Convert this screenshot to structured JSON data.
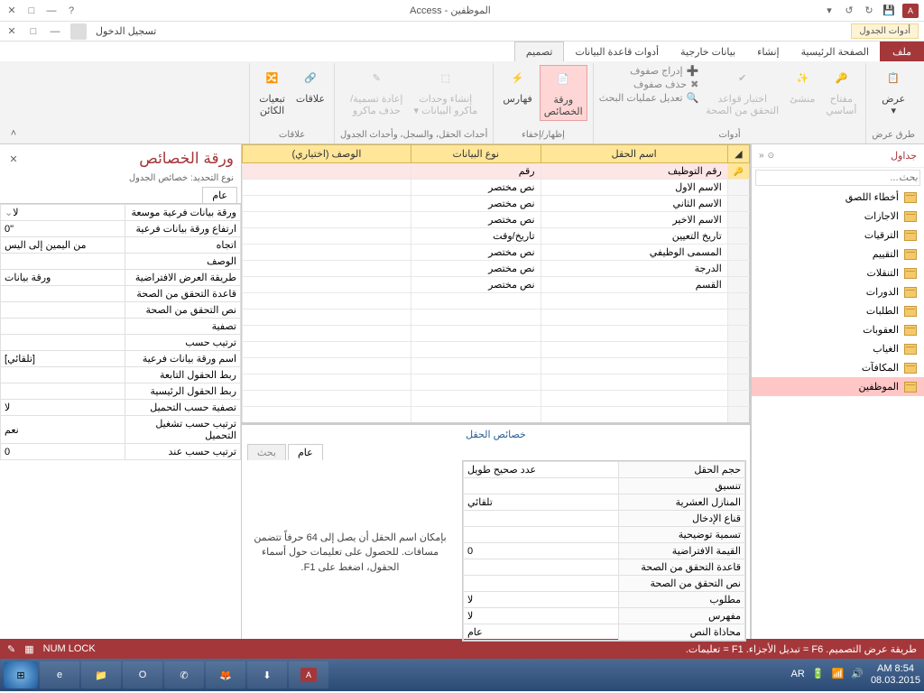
{
  "title": "الموظفين - Access",
  "signin": "تسجيل الدخول",
  "toolContext": "أدوات الجدول",
  "tabs": {
    "file": "ملف",
    "home": "الصفحة الرئيسية",
    "create": "إنشاء",
    "external": "بيانات خارجية",
    "dbtools": "أدوات قاعدة البيانات",
    "design": "تصميم"
  },
  "ribbon": {
    "view": "عرض",
    "viewGroup": "طرق عرض",
    "pk": "مفتاح\nأساسي",
    "builder": "منشئ",
    "testRules": "اختبار قواعد\nالتحقق من الصحة",
    "insertRows": "إدراج صفوف",
    "deleteRows": "حذف صفوف",
    "modifyLookups": "تعديل عمليات البحث",
    "toolsGroup": "أدوات",
    "propSheet": "ورقة\nالخصائص",
    "indexes": "فهارس",
    "showHide": "إظهار/إخفاء",
    "createMacros": "إنشاء وحدات\nماكرو البيانات ▾",
    "renameMacro": "إعادة تسمية/\nحذف ماكرو",
    "eventsGroup": "أحداث الحقل، والسجل، وأحداث الجدول",
    "relationships": "علاقات",
    "objDeps": "تبعيات\nالكائن",
    "relGroup": "علاقات"
  },
  "nav": {
    "head": "جداول",
    "search": "بحث...",
    "items": [
      "أخطاء اللصق",
      "الاجازات",
      "الترقيات",
      "التقييم",
      "التنقلات",
      "الدورات",
      "الطلبات",
      "العقوبات",
      "الغياب",
      "المكافآت",
      "الموظفين"
    ]
  },
  "grid": {
    "h1": "اسم الحقل",
    "h2": "نوع البيانات",
    "h3": "الوصف (اختياري)",
    "rows": [
      {
        "f": "رقم التوظيف",
        "t": "رقم"
      },
      {
        "f": "الاسم الاول",
        "t": "نص مختصر"
      },
      {
        "f": "الاسم الثاني",
        "t": "نص مختصر"
      },
      {
        "f": "الاسم الاخير",
        "t": "نص مختصر"
      },
      {
        "f": "تاريخ التعيين",
        "t": "تاريخ/وقت"
      },
      {
        "f": "المسمى الوظيفي",
        "t": "نص مختصر"
      },
      {
        "f": "الدرجة",
        "t": "نص مختصر"
      },
      {
        "f": "القسم",
        "t": "نص مختصر"
      }
    ]
  },
  "fieldProps": {
    "title": "خصائص الحقل",
    "tabGeneral": "عام",
    "tabLookup": "بحث",
    "hint": "بإمكان اسم الحقل أن يصل إلى 64 حرفاً تتضمن مسافات. للحصول على تعليمات حول أسماء الحقول، اضغط على F1.",
    "rows": [
      {
        "l": "حجم الحقل",
        "v": "عدد صحيح طويل"
      },
      {
        "l": "تنسيق",
        "v": ""
      },
      {
        "l": "المنازل العشرية",
        "v": "تلقائي"
      },
      {
        "l": "قناع الإدخال",
        "v": ""
      },
      {
        "l": "تسمية توضيحية",
        "v": ""
      },
      {
        "l": "القيمة الافتراضية",
        "v": "0"
      },
      {
        "l": "قاعدة التحقق من الصحة",
        "v": ""
      },
      {
        "l": "نص التحقق من الصحة",
        "v": ""
      },
      {
        "l": "مطلوب",
        "v": "لا"
      },
      {
        "l": "مفهرس",
        "v": "لا"
      },
      {
        "l": "محاذاة النص",
        "v": "عام"
      }
    ]
  },
  "propSheet": {
    "title": "ورقة الخصائص",
    "sub": "نوع التحديد: خصائص الجدول",
    "tab": "عام",
    "rows": [
      {
        "l": "ورقة بيانات فرعية موسعة",
        "v": "لا"
      },
      {
        "l": "ارتفاع ورقة بيانات فرعية",
        "v": "0\""
      },
      {
        "l": "اتجاه",
        "v": "من اليمين إلى اليس"
      },
      {
        "l": "الوصف",
        "v": ""
      },
      {
        "l": "طريقة العرض الافتراضية",
        "v": "ورقة بيانات"
      },
      {
        "l": "قاعدة التحقق من الصحة",
        "v": ""
      },
      {
        "l": "نص التحقق من الصحة",
        "v": ""
      },
      {
        "l": "تصفية",
        "v": ""
      },
      {
        "l": "ترتيب حسب",
        "v": ""
      },
      {
        "l": "اسم ورقة بيانات فرعية",
        "v": "[تلقائي]"
      },
      {
        "l": "ربط الحقول التابعة",
        "v": ""
      },
      {
        "l": "ربط الحقول الرئيسية",
        "v": ""
      },
      {
        "l": "تصفية حسب التحميل",
        "v": "لا"
      },
      {
        "l": "ترتيب حسب تشغيل التحميل",
        "v": "نعم"
      },
      {
        "l": "ترتيب حسب عند",
        "v": "0"
      }
    ]
  },
  "status": {
    "left": "طريقة عرض التصميم. F6 = تبديل الأجزاء. F1 = تعليمات.",
    "numlock": "NUM LOCK"
  },
  "taskbar": {
    "lang": "AR",
    "time": "AM 8:54",
    "date": "08.03.2015"
  }
}
